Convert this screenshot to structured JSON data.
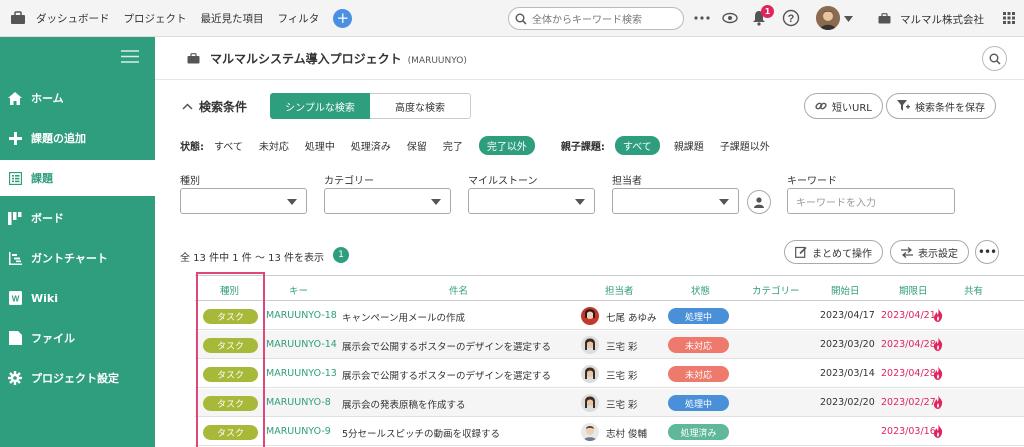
{
  "topbar": {
    "nav": [
      "ダッシュボード",
      "プロジェクト",
      "最近見た項目",
      "フィルタ"
    ],
    "add_icon": "plus-circle-icon",
    "search_placeholder": "全体からキーワード検索",
    "notification_count": "1",
    "company": "マルマル株式会社"
  },
  "sidebar": {
    "items": [
      {
        "label": "ホーム",
        "icon": "home-icon"
      },
      {
        "label": "課題の追加",
        "icon": "plus-icon"
      },
      {
        "label": "課題",
        "icon": "list-icon"
      },
      {
        "label": "ボード",
        "icon": "board-icon"
      },
      {
        "label": "ガントチャート",
        "icon": "gantt-icon"
      },
      {
        "label": "Wiki",
        "icon": "wiki-icon"
      },
      {
        "label": "ファイル",
        "icon": "folder-icon"
      },
      {
        "label": "プロジェクト設定",
        "icon": "gear-icon"
      }
    ],
    "active_index": 2
  },
  "project": {
    "title": "マルマルシステム導入プロジェクト",
    "key": "(MARUUNYO)"
  },
  "search": {
    "title": "検索条件",
    "simple_tab": "シンプルな検索",
    "advanced_tab": "高度な検索",
    "short_url": "短いURL",
    "save_condition": "検索条件を保存",
    "status_label": "状態:",
    "status_options": [
      "すべて",
      "未対応",
      "処理中",
      "処理済み",
      "保留",
      "完了",
      "完了以外"
    ],
    "status_selected": "完了以外",
    "parent_label": "親子課題:",
    "parent_options": [
      "すべて",
      "親課題",
      "子課題以外"
    ],
    "parent_selected": "すべて",
    "fields": {
      "type": "種別",
      "category": "カテゴリー",
      "milestone": "マイルストーン",
      "assignee": "担当者",
      "keyword": "キーワード"
    },
    "keyword_placeholder": "キーワードを入力"
  },
  "results": {
    "count_text": "全 13 件中 1 件 〜 13 件を表示",
    "badge": "1",
    "bulk_action": "まとめて操作",
    "display_settings": "表示設定"
  },
  "table": {
    "headers": {
      "type": "種別",
      "key": "キー",
      "subject": "件名",
      "assignee": "担当者",
      "status": "状態",
      "category": "カテゴリー",
      "start": "開始日",
      "due": "期限日",
      "share": "共有"
    },
    "rows": [
      {
        "type": "タスク",
        "key": "MARUUNYO-18",
        "subject": "キャンペーン用メールの作成",
        "assignee": "七尾 あゆみ",
        "status": "処理中",
        "status_color": "#4a90d9",
        "start": "2023/04/17",
        "due": "2023/04/21"
      },
      {
        "type": "タスク",
        "key": "MARUUNYO-14",
        "subject": "展示会で公開するポスターのデザインを選定する",
        "assignee": "三宅 彩",
        "status": "未対応",
        "status_color": "#ee7a6e",
        "start": "2023/03/20",
        "due": "2023/04/28"
      },
      {
        "type": "タスク",
        "key": "MARUUNYO-13",
        "subject": "展示会で公開するポスターのデザインを選定する",
        "assignee": "三宅 彩",
        "status": "未対応",
        "status_color": "#ee7a6e",
        "start": "2023/03/14",
        "due": "2023/04/28"
      },
      {
        "type": "タスク",
        "key": "MARUUNYO-8",
        "subject": "展示会の発表原稿を作成する",
        "assignee": "三宅 彩",
        "status": "処理中",
        "status_color": "#4a90d9",
        "start": "2023/02/20",
        "due": "2023/02/27"
      },
      {
        "type": "タスク",
        "key": "MARUUNYO-9",
        "subject": "5分セールスピッチの動画を収録する",
        "assignee": "志村 俊輔",
        "status": "処理済み",
        "status_color": "#5fb89a",
        "start": "",
        "due": "2023/03/16"
      }
    ]
  },
  "colors": {
    "accent": "#2e9e7e",
    "task_badge": "#a8b93a",
    "due_red": "#e0245e",
    "highlight": "#e0457b"
  }
}
